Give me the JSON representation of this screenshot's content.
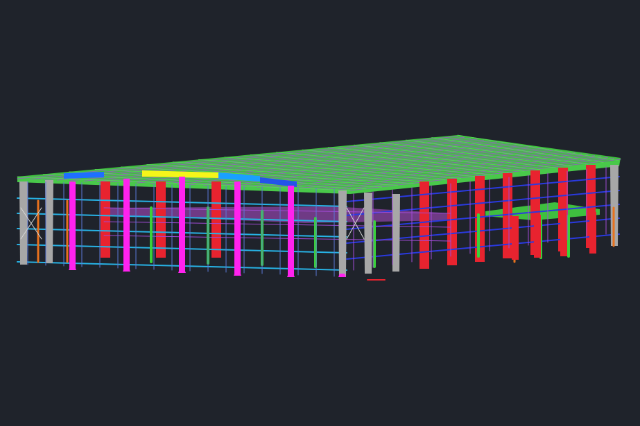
{
  "viewport": {
    "background": "#1f232b",
    "content": "3d-steel-frame-building-model"
  },
  "palette": {
    "roof": "#3fbf3f",
    "roof_stripe": "#8a6fb0",
    "column_gray": "#a7a7a7",
    "column_red": "#e8232f",
    "column_magenta": "#ff22ee",
    "column_green": "#39d13a",
    "column_orange": "#e8721d",
    "brace_cyan": "#27b3e6",
    "brace_blue": "#2a3ae0",
    "brace_purple": "#a14bd6",
    "beam_yellow": "#f5f51a",
    "beam_blue": "#2454e8",
    "mezzanine": "#b04fd0"
  }
}
